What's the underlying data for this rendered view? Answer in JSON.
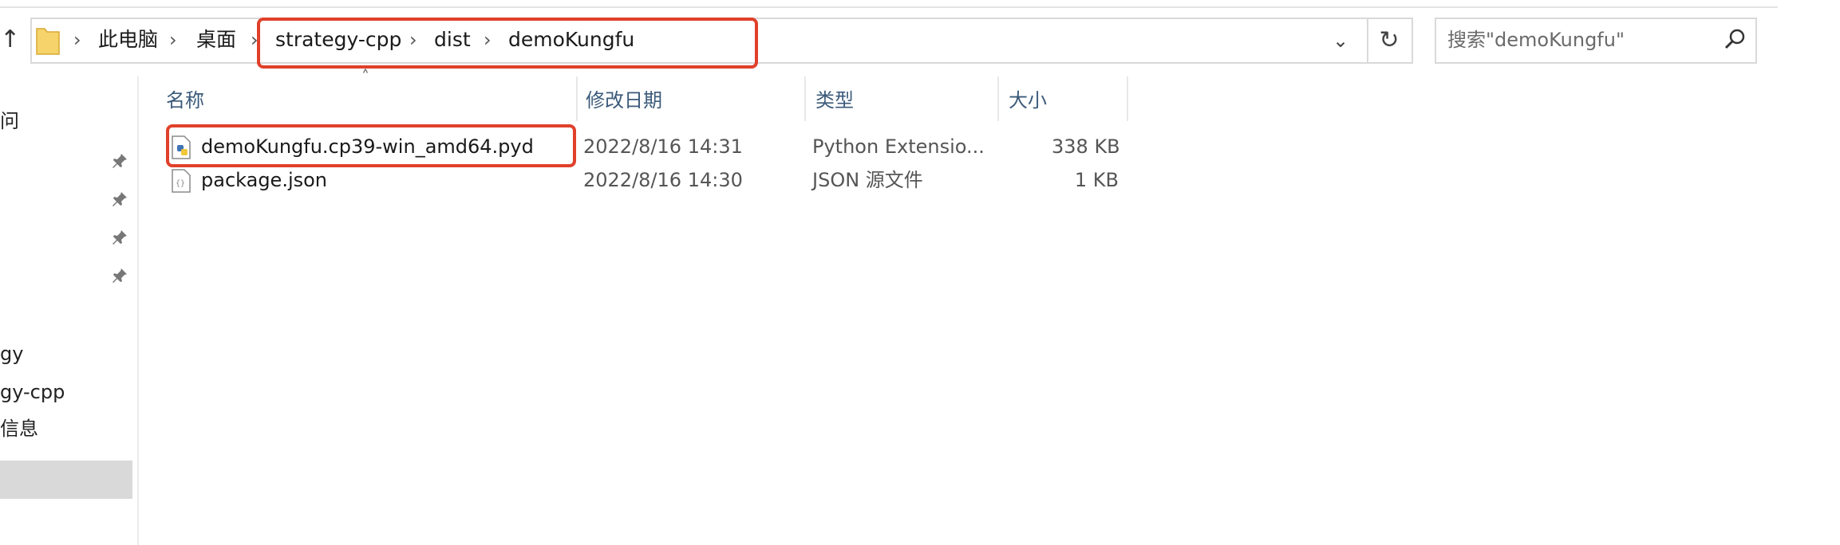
{
  "nav": {
    "up_glyph": "↑",
    "breadcrumb": [
      "此电脑",
      "桌面",
      "strategy-cpp",
      "dist",
      "demoKungfu"
    ],
    "separator": "›",
    "dropdown_glyph": "⌄",
    "refresh_glyph": "↻",
    "search_placeholder": "搜索\"demoKungfu\""
  },
  "sidebar": {
    "items": [
      {
        "label": "问"
      },
      {
        "label": "gy"
      },
      {
        "label": "gy-cpp"
      },
      {
        "label": "信息"
      }
    ]
  },
  "columns": [
    "名称",
    "修改日期",
    "类型",
    "大小"
  ],
  "files": [
    {
      "name": "demoKungfu.cp39-win_amd64.pyd",
      "modified": "2022/8/16 14:31",
      "type": "Python Extensio...",
      "size": "338 KB",
      "icon": "python-file-icon"
    },
    {
      "name": "package.json",
      "modified": "2022/8/16 14:30",
      "type": "JSON 源文件",
      "size": "1 KB",
      "icon": "json-file-icon"
    }
  ],
  "colors": {
    "highlight": "#e0402a",
    "header_text": "#3b5a7a",
    "selected_bg": "#d9d9d9"
  }
}
